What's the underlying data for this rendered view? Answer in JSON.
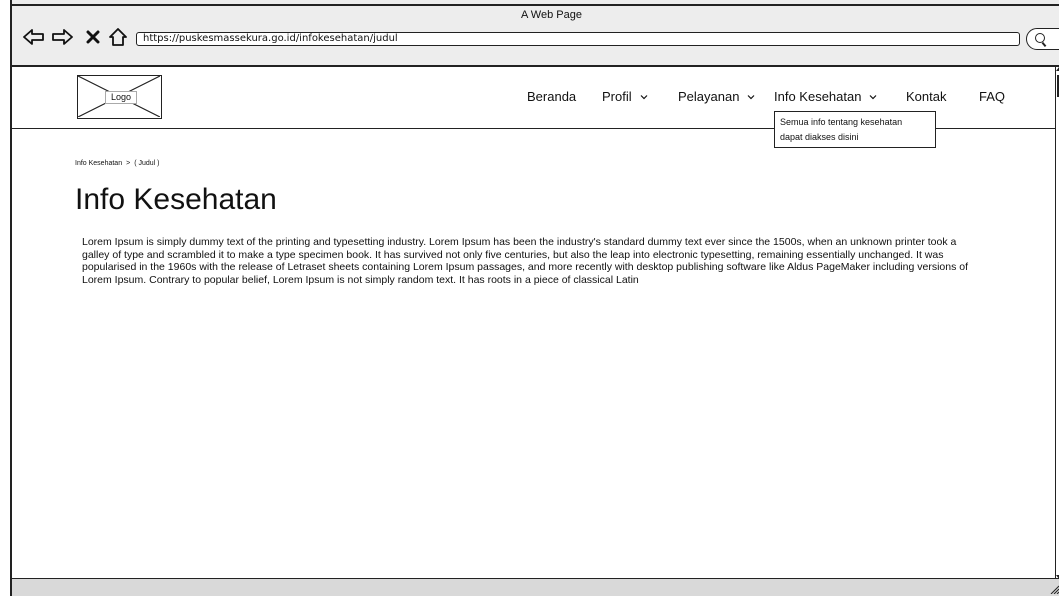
{
  "window": {
    "title": "A Web Page"
  },
  "browser": {
    "url": "https://puskesmassekura.go.id/infokesehatan/judul",
    "icons": [
      "back-arrow-icon",
      "forward-arrow-icon",
      "close-x-icon",
      "home-icon",
      "search-icon"
    ]
  },
  "header": {
    "logo_label": "Logo",
    "menu": [
      {
        "label": "Beranda",
        "has_dropdown": false
      },
      {
        "label": "Profil",
        "has_dropdown": true
      },
      {
        "label": "Pelayanan",
        "has_dropdown": true
      },
      {
        "label": "Info Kesehatan",
        "has_dropdown": true
      },
      {
        "label": "Kontak",
        "has_dropdown": false
      },
      {
        "label": "FAQ",
        "has_dropdown": false
      }
    ],
    "dropdown_text_line1": "Semua info tentang kesehatan",
    "dropdown_text_line2": "dapat diakses disini"
  },
  "breadcrumb": {
    "item1": "Info Kesehatan",
    "separator": ">",
    "item2": "( Judul )"
  },
  "main": {
    "title": "Info Kesehatan",
    "body": "Lorem Ipsum is simply dummy text of the printing and typesetting industry. Lorem Ipsum has been the industry's standard dummy text ever since the 1500s, when an unknown printer took a galley of type and scrambled it to make a type specimen book. It has survived not only five centuries, but also the leap into electronic typesetting, remaining essentially unchanged. It was popularised in the 1960s with the release of Letraset sheets containing Lorem Ipsum passages, and more recently with desktop publishing software like Aldus PageMaker including versions of Lorem Ipsum. Contrary to popular belief, Lorem Ipsum is not simply random text. It has roots in a piece of classical Latin"
  }
}
